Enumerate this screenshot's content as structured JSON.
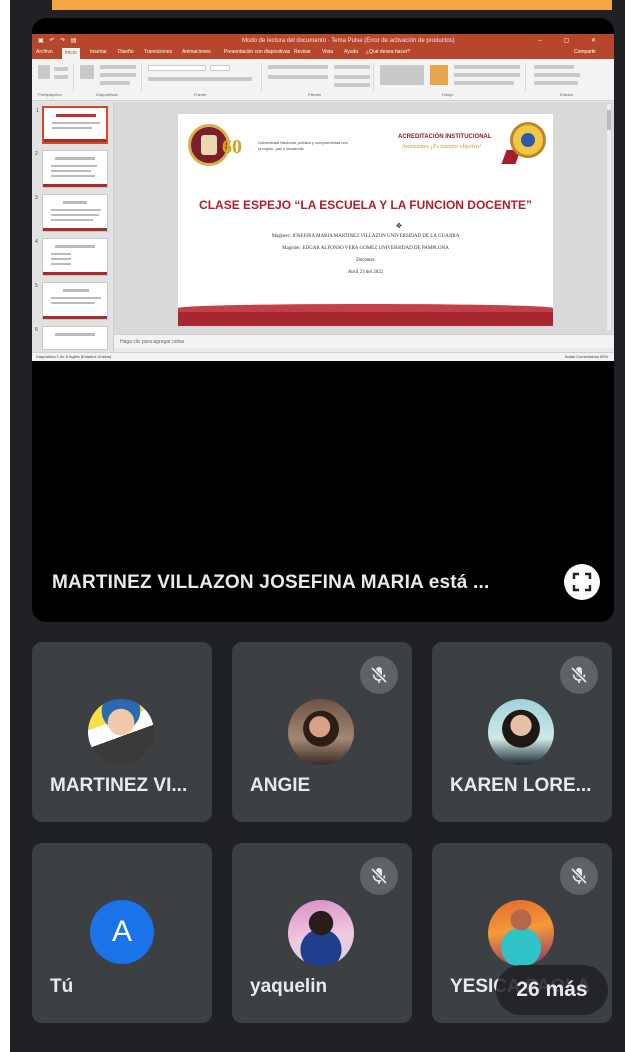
{
  "colors": {
    "app_background": "#202124",
    "tile_background": "#3c4043",
    "accent_orange": "#f5a541",
    "powerpoint_red": "#b7472a",
    "slide_title_red": "#b11e29",
    "avatar_blue": "#1a73e8"
  },
  "shared_screen": {
    "window_title": "Modo de lectura del documento · Tema Pulse (Error de activación de productos)",
    "ribbon_tabs": [
      "Archivo",
      "Inicio",
      "Insertar",
      "Diseño",
      "Transiciones",
      "Animaciones",
      "Presentación con diapositivas",
      "Revisar",
      "Vista",
      "Ayuda",
      "¿Qué desea hacer?",
      "Compartir"
    ],
    "active_tab": "Inicio",
    "ribbon_groups": [
      "Portapapeles",
      "Diapositivas",
      "Fuente",
      "Párrafo",
      "Dibujo",
      "Edición"
    ],
    "slide": {
      "logo_text": "60",
      "slogan": "Universidad Nacional, pública y comprometida con la región, paz y desarrollo",
      "accreditation_title": "ACREDITACIÓN INSTITUCIONAL",
      "accreditation_subtitle": "Avanzamos ¡Es nuestro objetivo!",
      "title": "CLASE ESPEJO “LA ESCUELA Y LA FUNCION DOCENTE”",
      "lines": [
        "Magíster: JOSEFINA MARIA MARTINEZ VILLAZON UNIVERSIDAD DE LA GUAJIRA",
        "Magíster: EDGAR ALFONSO VERA GOMEZ UNIVERSIDAD DE PAMPLONA",
        "Docentes",
        "Abril 23 del 2022"
      ]
    },
    "thumbnail_numbers": [
      "1",
      "2",
      "3",
      "4",
      "5",
      "6"
    ],
    "notes_placeholder": "Haga clic para agregar notas",
    "status_left": "Diapositiva 1 de 8   Inglés (Estados Unidos)",
    "status_right": "Notas   Comentarios   69%"
  },
  "main_tile": {
    "presenter_label": "MARTINEZ VILLAZON JOSEFINA MARIA está ...",
    "fullscreen_icon": "fullscreen-icon"
  },
  "participants": [
    {
      "name": "MARTINEZ VI...",
      "muted": false,
      "avatar": "photo"
    },
    {
      "name": "ANGIE",
      "muted": true,
      "avatar": "photo"
    },
    {
      "name": "KAREN LORE...",
      "muted": true,
      "avatar": "photo"
    },
    {
      "name": "Tú",
      "muted": false,
      "avatar": "letter",
      "letter": "A"
    },
    {
      "name": "yaquelin",
      "muted": true,
      "avatar": "photo"
    },
    {
      "name": "YESICA PAOLA",
      "muted": true,
      "avatar": "photo"
    }
  ],
  "more_participants_label": "26 más"
}
